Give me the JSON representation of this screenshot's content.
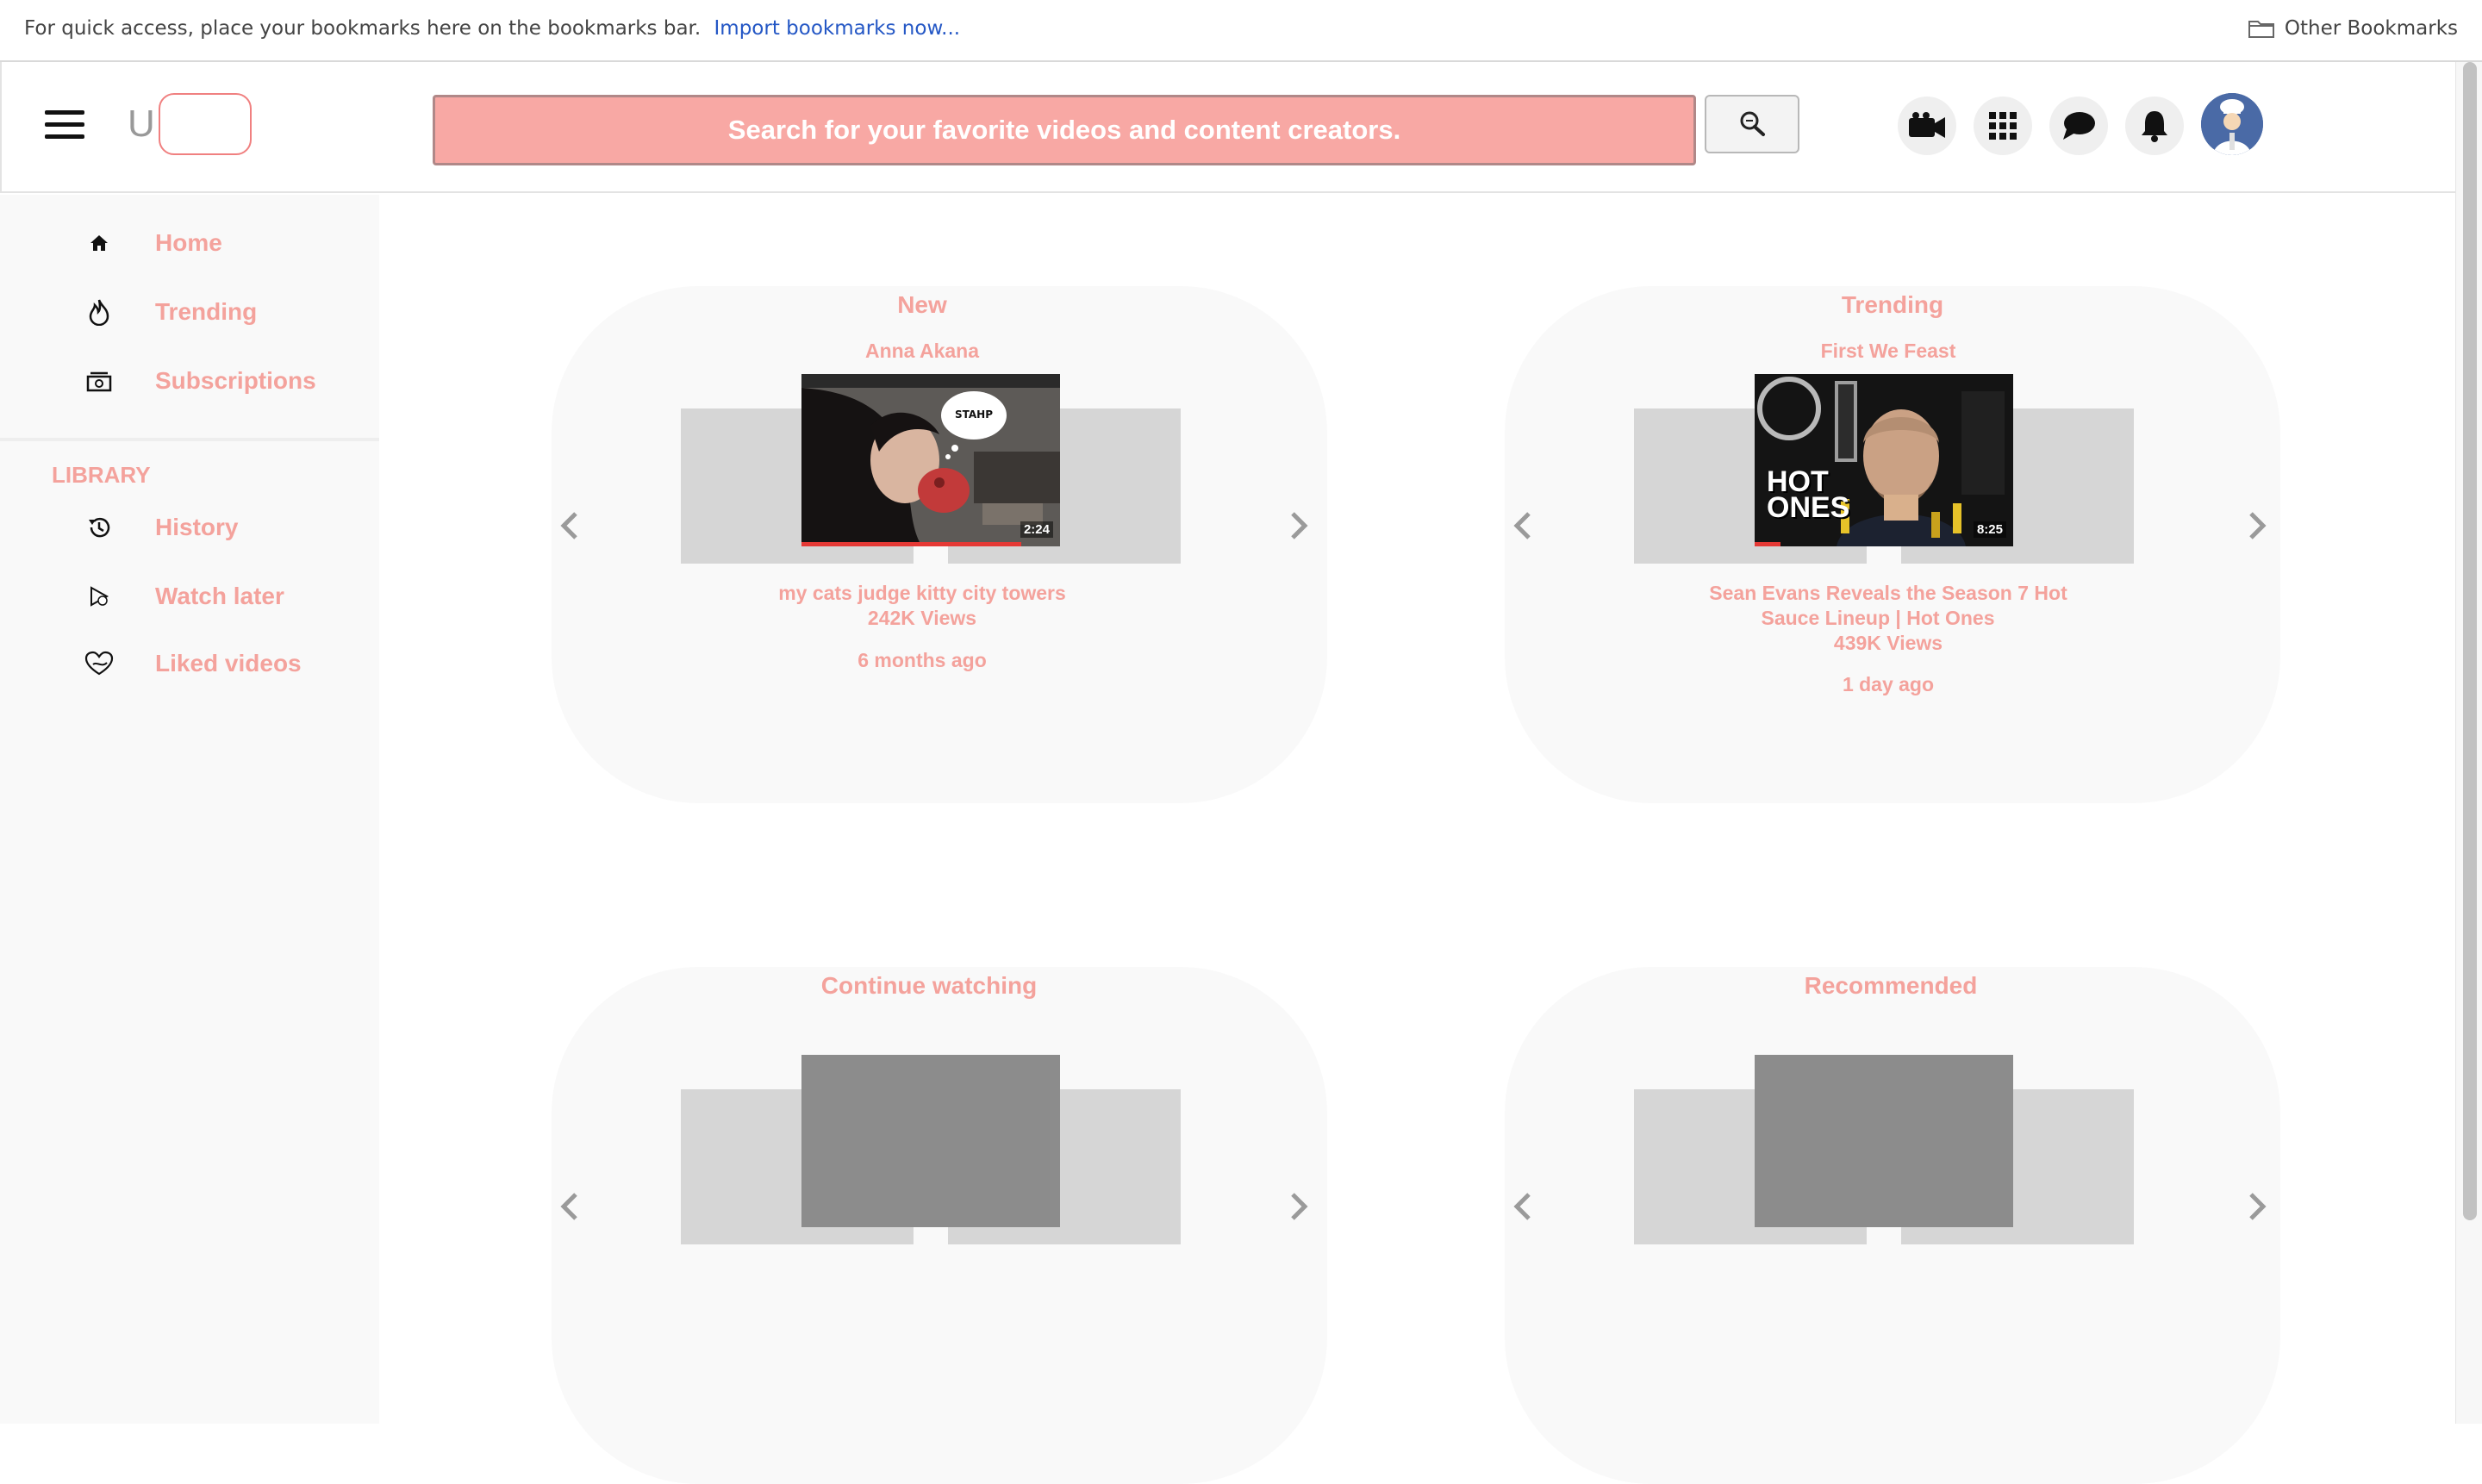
{
  "bookmarks_bar": {
    "hint": "For quick access, place your bookmarks here on the bookmarks bar.",
    "import_link": "Import bookmarks now...",
    "other_bookmarks": "Other Bookmarks"
  },
  "header": {
    "logo_letter": "U",
    "search_placeholder": "Search for your favorite videos and content creators."
  },
  "sidebar": {
    "items": [
      {
        "label": "Home",
        "icon": "home-icon"
      },
      {
        "label": "Trending",
        "icon": "flame-icon"
      },
      {
        "label": "Subscriptions",
        "icon": "subscriptions-icon"
      }
    ],
    "library_heading": "LIBRARY",
    "library_items": [
      {
        "label": "History",
        "icon": "history-icon"
      },
      {
        "label": "Watch later",
        "icon": "watch-later-icon"
      },
      {
        "label": "Liked videos",
        "icon": "heart-icon"
      }
    ]
  },
  "panels": {
    "new": {
      "title": "New",
      "channel": "Anna Akana",
      "video_title": "my cats judge kitty city towers",
      "views": "242K Views",
      "age": "6 months ago",
      "duration": "2:24",
      "bubble_text": "STAHP",
      "progress": 0.85
    },
    "trending": {
      "title": "Trending",
      "channel": "First We Feast",
      "video_title_line1": "Sean Evans Reveals the Season 7 Hot",
      "video_title_line2": "Sauce Lineup | Hot Ones",
      "views": "439K Views",
      "age": "1 day ago",
      "duration": "8:25",
      "logo_text_1": "HOT",
      "logo_text_2": "ONES",
      "progress": 0.1
    },
    "continue_watching": {
      "title": "Continue watching"
    },
    "recommended": {
      "title": "Recommended"
    }
  },
  "colors": {
    "accent": "#f4a29c",
    "search_bg": "#f8a8a4",
    "panel_bg": "#f9f9f9",
    "card_light": "#d6d6d6",
    "card_dark": "#8c8c8c"
  }
}
